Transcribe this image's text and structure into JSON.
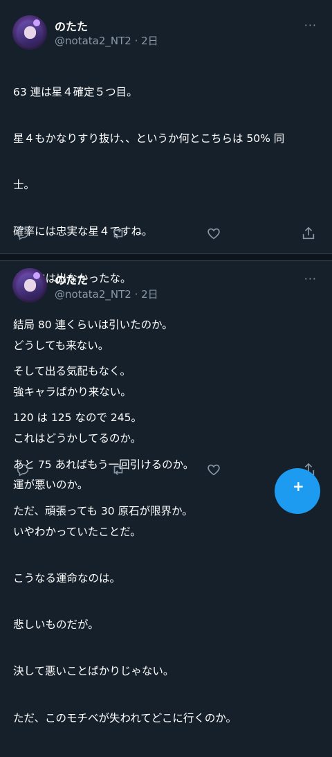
{
  "tweets": [
    {
      "author_name": "のたた",
      "handle_time": "@notata2_NT2 · 2日",
      "more": "···",
      "lines": [
        "63 連は星４確定５つ目。",
        "星４もかなりすり抜け、、というか何とこちらは 50% 同",
        "士。",
        "確率には忠実な星４ですね。",
        "トーマは出なかったな。",
        "結局 80 連くらいは引いたのか。",
        "そして出る気配もなく。",
        "120 は 125 なので 245。",
        "あと 75 あればもう一回引けるのか。",
        "ただ、頑張っても 30 原石が限界か。"
      ]
    },
    {
      "author_name": "のたた",
      "handle_time": "@notata2_NT2 · 2日",
      "more": "···",
      "lines": [
        "どうしても来ない。",
        "強キャラばかり来ない。",
        "これはどうかしてるのか。",
        "運が悪いのか。",
        "いやわかっていたことだ。",
        "こうなる運命なのは。",
        "悲しいものだが。",
        "決して悪いことばかりじゃない。",
        "ただ、このモチベが失われてどこに行くのか。"
      ]
    }
  ],
  "fab_label": "+",
  "icons": [
    "reply-icon",
    "retweet-icon",
    "like-icon",
    "share-icon"
  ],
  "colors": {
    "background": "#15202b",
    "secondary_text": "#8b98a5",
    "accent": "#1d9bf0"
  }
}
